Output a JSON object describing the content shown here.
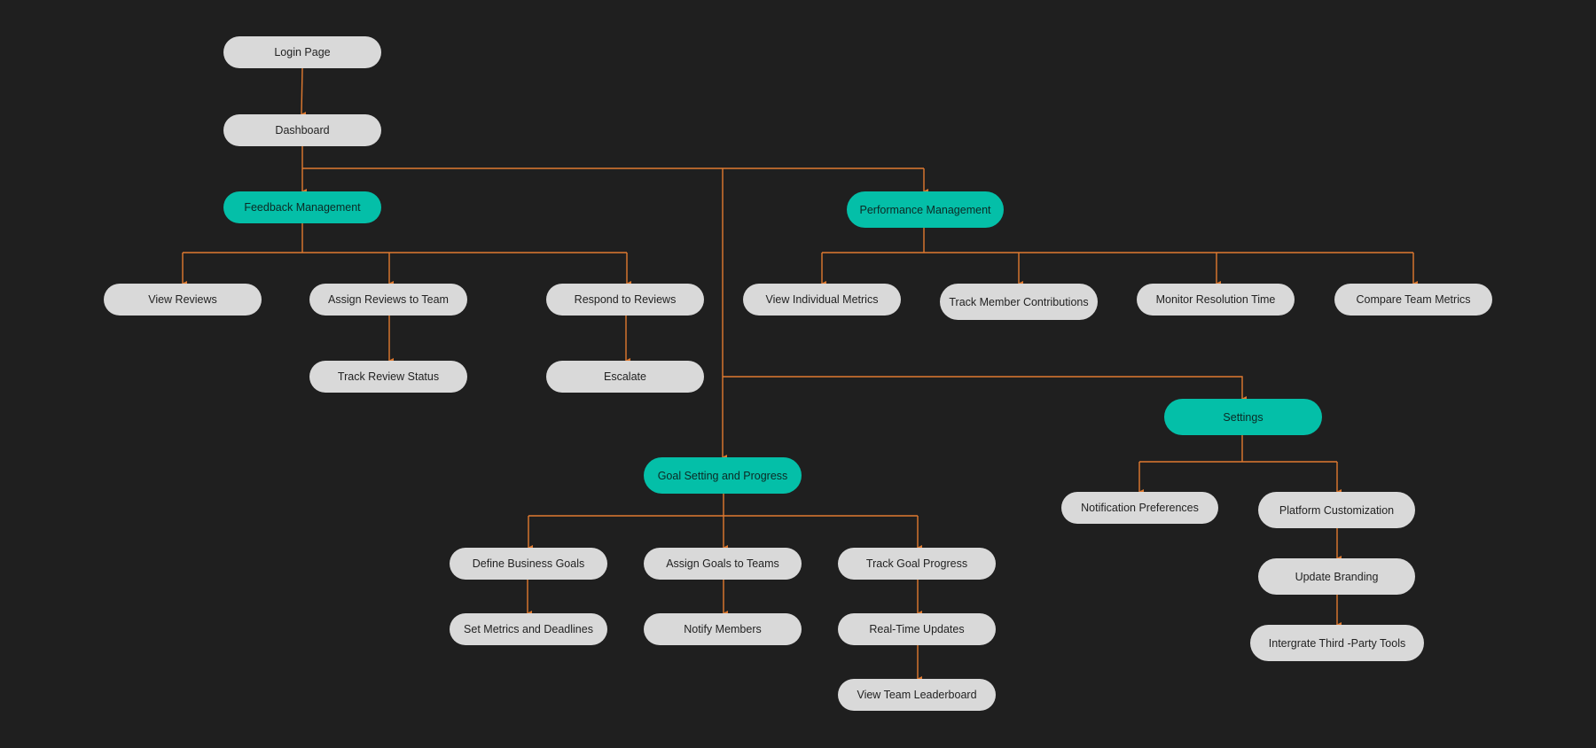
{
  "colors": {
    "background": "#1f1f1f",
    "node": "#d9d9d9",
    "accent_node": "#04bfa8",
    "connector": "#e07a30"
  },
  "nodes": {
    "login_page": "Login Page",
    "dashboard": "Dashboard",
    "feedback_management": "Feedback Management",
    "performance_management": "Performance Management",
    "view_reviews": "View Reviews",
    "assign_reviews": "Assign Reviews to Team",
    "respond_reviews": "Respond to Reviews",
    "track_review_status": "Track Review Status",
    "escalate": "Escalate",
    "view_individual_metrics": "View Individual Metrics",
    "track_member_contributions": "Track Member Contributions",
    "monitor_resolution_time": "Monitor Resolution Time",
    "compare_team_metrics": "Compare Team Metrics",
    "settings": "Settings",
    "notification_preferences": "Notification Preferences",
    "platform_customization": "Platform Customization",
    "update_branding": "Update Branding",
    "integrate_third_party": "Intergrate Third -Party Tools",
    "goal_setting": "Goal Setting and Progress",
    "define_business_goals": "Define Business Goals",
    "assign_goals": "Assign Goals to Teams",
    "track_goal_progress": "Track Goal Progress",
    "set_metrics": "Set Metrics and Deadlines",
    "notify_members": "Notify Members",
    "real_time_updates": "Real-Time Updates",
    "view_team_leaderboard": "View Team Leaderboard"
  }
}
